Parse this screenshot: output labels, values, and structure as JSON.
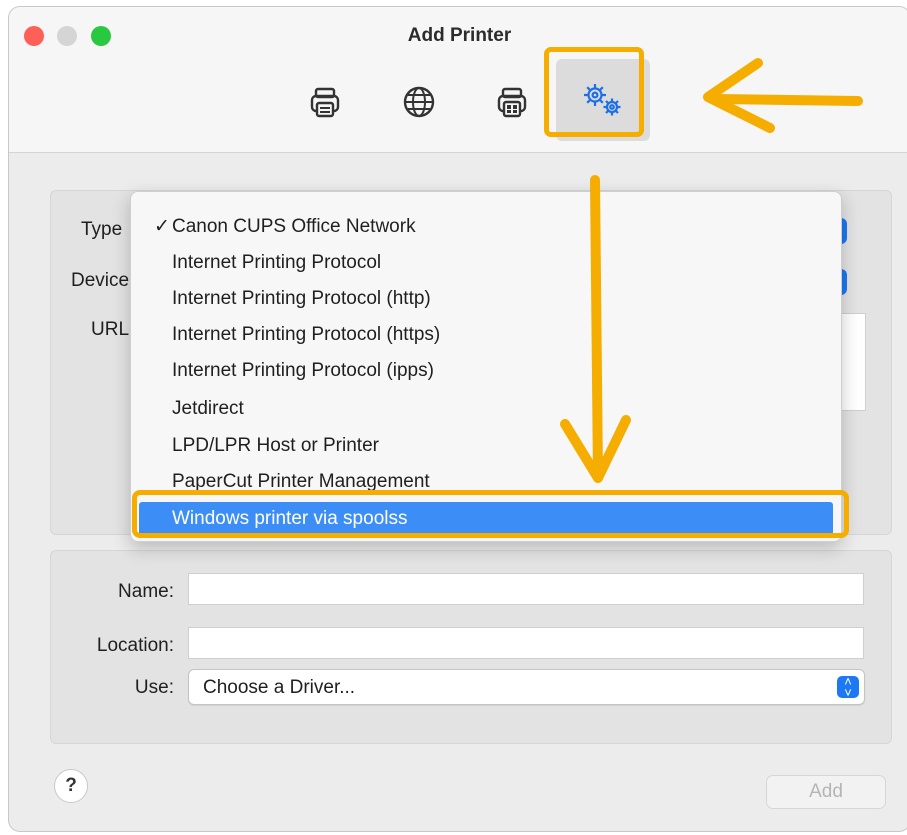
{
  "window": {
    "title": "Add Printer"
  },
  "toolbar": {
    "icons": [
      "printer-icon",
      "globe-icon",
      "windows-printer-icon",
      "gears-icon"
    ],
    "selected": "advanced"
  },
  "form": {
    "type_label": "Type",
    "device_label": "Device",
    "url_label": "URL",
    "name_label": "Name:",
    "name_value": "",
    "location_label": "Location:",
    "location_value": "",
    "use_label": "Use:",
    "use_value": "Choose a Driver..."
  },
  "menu": {
    "items": [
      {
        "label": "Canon CUPS Office Network",
        "checked": true
      },
      {
        "label": "Internet Printing Protocol"
      },
      {
        "label": "Internet Printing Protocol (http)"
      },
      {
        "label": "Internet Printing Protocol (https)"
      },
      {
        "label": "Internet Printing Protocol (ipps)"
      },
      {
        "label": "Jetdirect"
      },
      {
        "label": "LPD/LPR Host or Printer"
      },
      {
        "label": "PaperCut Printer Management"
      },
      {
        "label": "Windows printer via spoolss",
        "highlighted": true
      }
    ],
    "check_mark": "✓"
  },
  "footer": {
    "help_label": "?",
    "add_label": "Add"
  },
  "colors": {
    "accent": "#1c78f5",
    "highlight": "#3c8ef6",
    "annotation": "#f5ad00"
  }
}
